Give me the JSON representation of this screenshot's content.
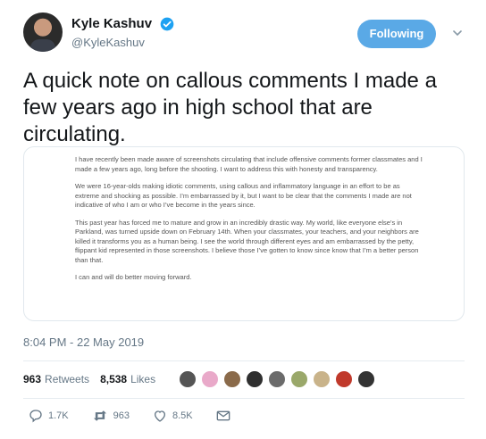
{
  "author": {
    "display_name": "Kyle Kashuv",
    "handle": "@KyleKashuv",
    "follow_label": "Following"
  },
  "tweet": {
    "text": "A quick note on callous comments I made a few years ago in high school that are circulating.",
    "note_paragraphs": [
      "I have recently been made aware of screenshots circulating that include offensive comments former classmates and I made a few years ago, long before the shooting. I want to address this with honesty and transparency.",
      "We were 16-year-olds making idiotic comments, using callous and inflammatory language in an effort to be as extreme and shocking as possible. I’m embarrassed by it, but I want to be clear that the comments I made are not indicative of who I am or who I’ve become in the years since.",
      "This past year has forced me to mature and grow in an incredibly drastic way. My world, like everyone else’s in Parkland, was turned upside down on February 14th. When your classmates, your teachers, and your neighbors are killed it transforms you as a human being. I see the world through different eyes and am embarrassed by the petty, flippant kid represented in those screenshots. I believe those I’ve gotten to know since know that I’m a better person than that.",
      "I can and will do better moving forward."
    ],
    "timestamp": "8:04 PM - 22 May 2019"
  },
  "stats": {
    "retweets_count": "963",
    "retweets_label": "Retweets",
    "likes_count": "8,538",
    "likes_label": "Likes",
    "liker_avatar_colors": [
      "#555555",
      "#e9a9c9",
      "#8a6a4a",
      "#2f2f2f",
      "#6b6b6b",
      "#9aa86a",
      "#c9b38a",
      "#c0392b",
      "#333333"
    ]
  },
  "actions": {
    "reply_count": "1.7K",
    "retweet_count": "963",
    "like_count": "8.5K"
  },
  "colors": {
    "accent": "#1da1f2",
    "follow_bg": "#5aa9e6",
    "muted": "#657786"
  }
}
